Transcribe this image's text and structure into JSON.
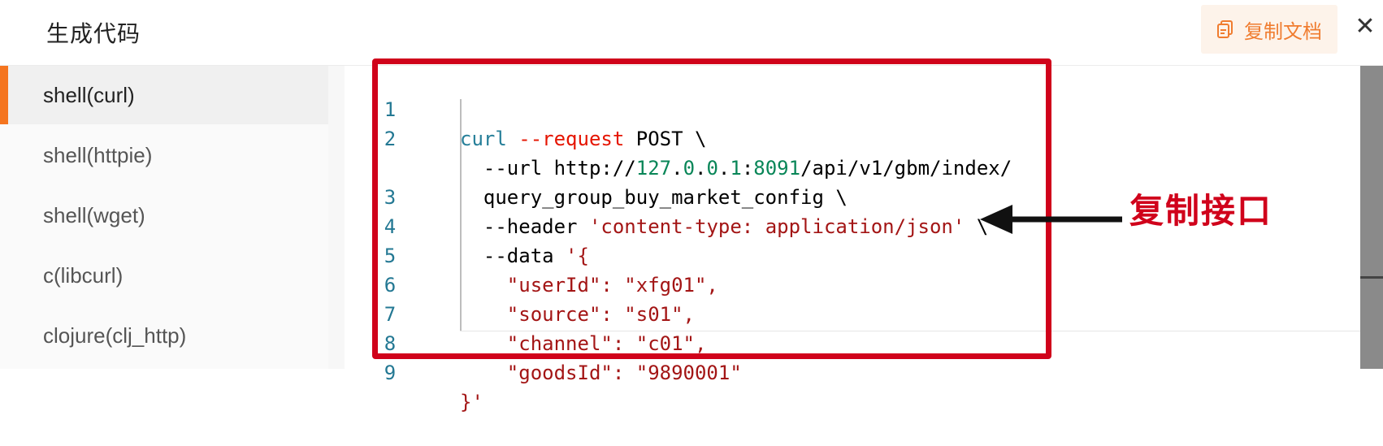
{
  "header": {
    "title": "生成代码",
    "copy_doc_label": "复制文档",
    "close_symbol": "✕"
  },
  "sidebar": {
    "items": [
      {
        "label": "shell(curl)",
        "active": true
      },
      {
        "label": "shell(httpie)",
        "active": false
      },
      {
        "label": "shell(wget)",
        "active": false
      },
      {
        "label": "c(libcurl)",
        "active": false
      },
      {
        "label": "clojure(clj_http)",
        "active": false
      }
    ]
  },
  "code": {
    "lines": [
      {
        "num": "1",
        "text": "curl --request POST \\"
      },
      {
        "num": "2",
        "text": "  --url http://127.0.0.1:8091/api/v1/gbm/index/"
      },
      {
        "num": "",
        "text": "  query_group_buy_market_config \\"
      },
      {
        "num": "3",
        "text": "  --header 'content-type: application/json' \\"
      },
      {
        "num": "4",
        "text": "  --data '{"
      },
      {
        "num": "5",
        "text": "    \"userId\": \"xfg01\","
      },
      {
        "num": "6",
        "text": "    \"source\": \"s01\","
      },
      {
        "num": "7",
        "text": "    \"channel\": \"c01\","
      },
      {
        "num": "8",
        "text": "    \"goodsId\": \"9890001\""
      },
      {
        "num": "9",
        "text": "}'"
      }
    ]
  },
  "annotation": {
    "text": "复制接口",
    "color": "#d0021b"
  },
  "colors": {
    "accent": "#f5751f",
    "highlight": "#d0021b"
  }
}
